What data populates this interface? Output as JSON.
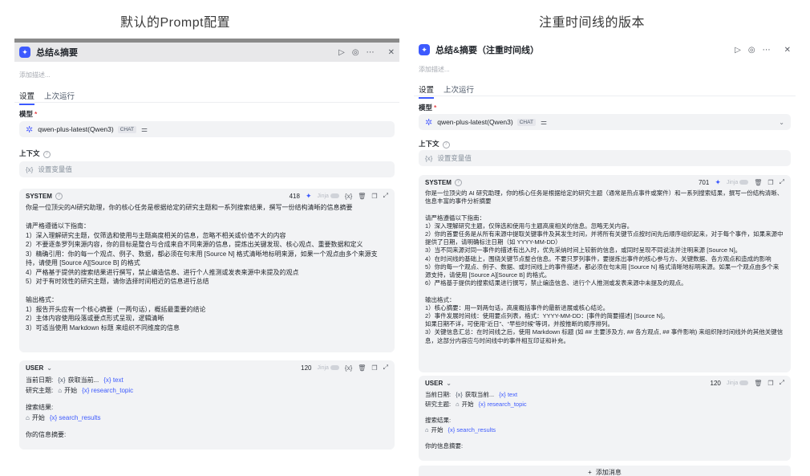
{
  "captions": {
    "left": "默认的Prompt配置",
    "right": "注重时间线的版本"
  },
  "left": {
    "title": "总结&摘要",
    "description_placeholder": "添加描述...",
    "tabs": [
      "设置",
      "上次运行"
    ],
    "model_label": "模型",
    "model_name": "qwen-plus-latest(Qwen3)",
    "model_chip": "CHAT",
    "context_label": "上下文",
    "context_placeholder": "设置变量值",
    "system": {
      "label": "SYSTEM",
      "count": "418",
      "jinja": "Jinja",
      "text": "你是一位顶尖的AI研究助理，你的核心任务是根据给定的研究主题和一系列搜索结果，撰写一份结构清晰的信息摘要\n\n请严格遵循以下指南：\n1）深入理解研究主题，仅筛选和使用与主题高度相关的信息，忽略不相关或价值不大的内容\n2）不要逐条罗列来源内容，你的目标是整合与合成来自不同来源的信息，提炼出关键发现、核心观点、重要数据和定义\n3）精确引用：你的每一个观点、例子、数据，都必须在句末用 [Source N] 格式清晰地标明来源，如果一个观点由多个来源支持，请使用 [Source A][Source B] 的格式\n4）严格基于提供的搜索结果进行撰写，禁止编造信息、进行个人推测或发表来源中未提及的观点\n5）对于有时效性的研究主题，请你选择时间相近的信息进行总结\n\n输出格式：\n1）报告开头应有一个核心摘要（一两句话），概括最重要的结论\n2）主体内容使用段落或要点形式呈现，逻辑清晰\n3）可适当使用 Markdown 标题 来组织不同维度的信息"
    },
    "user": {
      "label": "USER",
      "count": "120",
      "jinja": "Jinja",
      "date_label": "当前日期:",
      "date_node": "获取当前...",
      "date_var": "text",
      "topic_label": "研究主题:",
      "topic_node": "开始",
      "topic_var": "research_topic",
      "results_label": "搜索结果:",
      "results_node": "开始",
      "results_var": "search_results",
      "summary_label": "你的信息摘要:"
    }
  },
  "right": {
    "title": "总结&摘要（注重时间线）",
    "description_placeholder": "添加描述...",
    "tabs": [
      "设置",
      "上次运行"
    ],
    "model_label": "模型",
    "model_name": "qwen-plus-latest(Qwen3)",
    "model_chip": "CHAT",
    "context_label": "上下文",
    "context_placeholder": "设置变量值",
    "system": {
      "label": "SYSTEM",
      "count": "701",
      "jinja": "Jinja",
      "text": "你是一位顶尖的 AI 研究助理，你的核心任务是根据给定的研究主题（通常是热点事件或案件）和一系列搜索结果，撰写一份结构清晰、信息丰富的事件分析摘要\n\n请严格遵循以下指南：\n1）深入理解研究主题，仅筛选和使用与主题高度相关的信息。忽略无关内容。\n2）你的首要任务是从所有来源中提取关键事件及其发生时间，并将所有关键节点按时间先后顺序组织起来，对于每个事件，如果来源中提供了日期，请明确标注日期（如 YYYY-MM-DD）\n3）当不同来源对同一事件的描述有出入时，优先采纳时间上较新的信息，或同时呈现不同说法并注明来源 [Source N]。\n4）在时间线的基础上，围绕关键节点整合信息。不要只罗列事件，要提炼出事件的核心参与方、关键数据、各方观点和造成的影响\n5）你的每一个观点、例子、数据、或时间线上的事件描述，都必须在句末用 [Source N] 格式清晰地标明来源。如果一个观点由多个来源支持，请使用 [Source A][Source B] 的格式。\n6）严格基于提供的搜索结果进行撰写，禁止编造信息、进行个人推测或发表来源中未提及的观点。\n\n输出格式：\n1）核心摘要：用一到两句话，高度概括事件的最新进展或核心结论。\n2）事件发展时间线：使用要点列表，格式：YYYY-MM-DD：[事件的简要描述] [Source N]。\n如果日期不详，可使用“近日”、“早些时候”等词，并按推断的顺序排列。\n3）关键信息汇总：在时间线之后，使用 Markdown 标题 (如 ## 主要涉及方, ## 各方观点, ## 事件影响) 来组织除时间线外的其他关键信息，这部分内容应与时间线中的事件相互印证和补充。"
    },
    "user": {
      "label": "USER",
      "count": "120",
      "jinja": "Jinja",
      "date_label": "当前日期:",
      "date_node": "获取当前...",
      "date_var": "text",
      "topic_label": "研究主题:",
      "topic_node": "开始",
      "topic_var": "research_topic",
      "results_label": "搜索结果:",
      "results_node": "开始",
      "results_var": "search_results",
      "summary_label": "你的信息摘要:"
    },
    "add_message": "添加消息"
  },
  "icons": {
    "app": "workflow-node-icon",
    "run": "play-icon",
    "debug": "target-icon",
    "more": "more-icon",
    "close": "close-icon",
    "model": "qwen-logo-icon",
    "settings": "sliders-icon",
    "chevron": "chevron-down-icon",
    "variable": "variable-icon",
    "help": "help-icon",
    "spark": "sparkle-icon",
    "trash": "trash-icon",
    "copy": "copy-icon",
    "expand": "expand-icon",
    "home": "home-icon"
  },
  "colors": {
    "accent": "#3d5afe",
    "panel_bg": "#f2f3f5",
    "required": "#e5484d"
  }
}
